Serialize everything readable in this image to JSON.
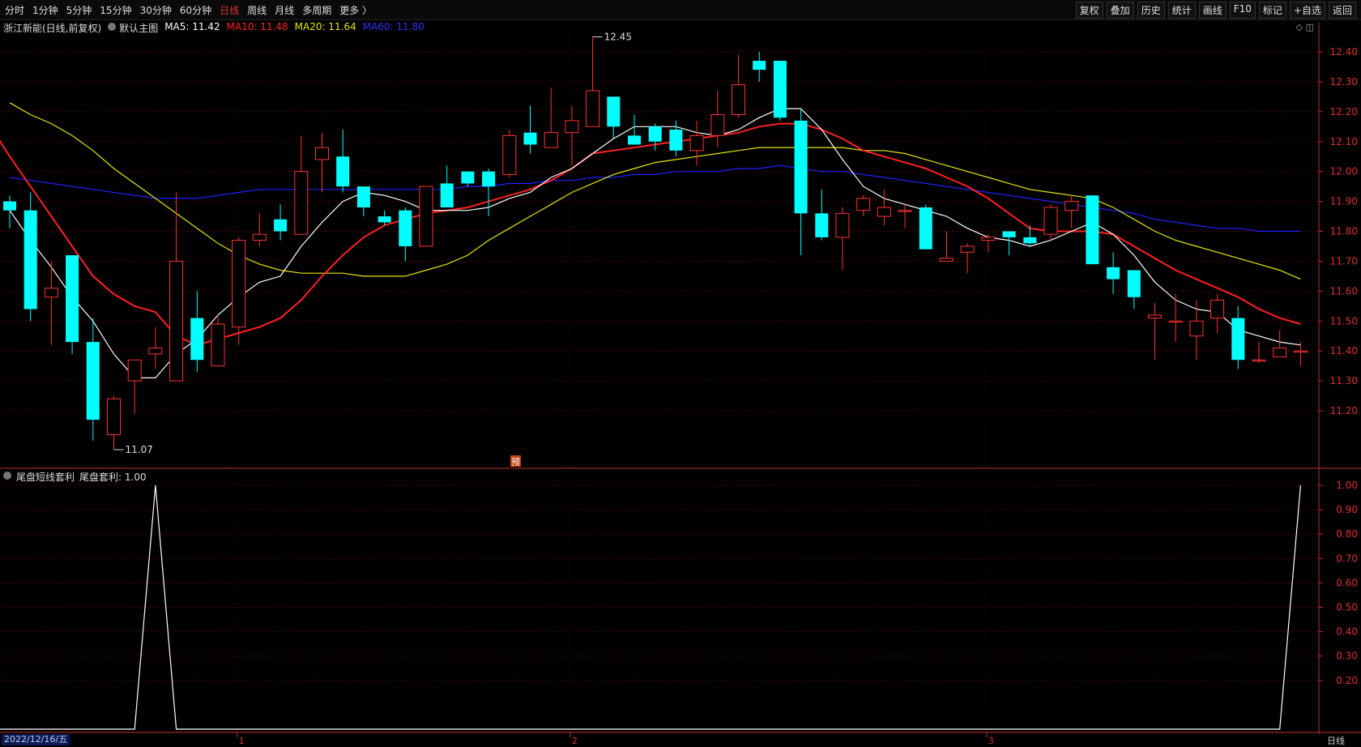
{
  "toolbar": {
    "periods": [
      "分时",
      "1分钟",
      "5分钟",
      "15分钟",
      "30分钟",
      "60分钟",
      "日线",
      "周线",
      "月线",
      "多周期",
      "更多 〉"
    ],
    "active": "日线",
    "right_buttons": [
      "复权",
      "叠加",
      "历史",
      "统计",
      "画线",
      "F10",
      "标记",
      "+自选",
      "返回"
    ]
  },
  "main_info": {
    "stock": "浙江新能(日线,前复权)",
    "template": "默认主图",
    "ma5": "MA5: 11.42",
    "ma10": "MA10: 11.48",
    "ma20": "MA20: 11.64",
    "ma60": "MA60: 11.80"
  },
  "sub_info": {
    "name": "尾盘短线套利",
    "value": "尾盘套利: 1.00"
  },
  "corner_icons": "◇ ◫",
  "pre_marker": "预",
  "bottom": {
    "date": "2022/12/16/五",
    "period": "日线"
  },
  "colors": {
    "up": "#ff3232",
    "down": "#00ffff",
    "ma5": "#ffffff",
    "ma10": "#ff2020",
    "ma20": "#e6e600",
    "ma60": "#2020ff",
    "grid": "#5a0000",
    "axis": "#c03030"
  },
  "chart_data": [
    {
      "type": "candlestick",
      "title": "浙江新能(日线,前复权)",
      "ylim": [
        11.07,
        12.45
      ],
      "yticks": [
        "12.40",
        "12.30",
        "12.20",
        "12.10",
        "12.00",
        "11.90",
        "11.80",
        "11.70",
        "11.60",
        "11.50",
        "11.40",
        "11.30",
        "11.20"
      ],
      "xticks": [
        "1",
        "2",
        "3"
      ],
      "xtick_index": [
        11,
        27,
        47
      ],
      "annotations": [
        {
          "text": "12.45",
          "index": 28,
          "value": 12.45
        },
        {
          "text": "11.07",
          "index": 5,
          "value": 11.07
        }
      ],
      "candles": [
        [
          11.9,
          11.87,
          11.92,
          11.81
        ],
        [
          11.87,
          11.54,
          11.93,
          11.5
        ],
        [
          11.58,
          11.61,
          11.7,
          11.42
        ],
        [
          11.72,
          11.43,
          11.72,
          11.39
        ],
        [
          11.43,
          11.17,
          11.51,
          11.1
        ],
        [
          11.12,
          11.24,
          11.25,
          11.07
        ],
        [
          11.3,
          11.37,
          11.37,
          11.19
        ],
        [
          11.39,
          11.41,
          11.48,
          11.34
        ],
        [
          11.3,
          11.7,
          11.93,
          11.3
        ],
        [
          11.51,
          11.37,
          11.6,
          11.33
        ],
        [
          11.35,
          11.49,
          11.52,
          11.35
        ],
        [
          11.48,
          11.77,
          11.78,
          11.42
        ],
        [
          11.77,
          11.79,
          11.86,
          11.75
        ],
        [
          11.84,
          11.8,
          11.89,
          11.77
        ],
        [
          11.79,
          12.0,
          12.12,
          11.79
        ],
        [
          12.04,
          12.08,
          12.13,
          11.93
        ],
        [
          12.05,
          11.95,
          12.14,
          11.93
        ],
        [
          11.95,
          11.88,
          11.95,
          11.85
        ],
        [
          11.85,
          11.83,
          11.87,
          11.82
        ],
        [
          11.87,
          11.75,
          11.88,
          11.7
        ],
        [
          11.75,
          11.95,
          11.95,
          11.75
        ],
        [
          11.96,
          11.88,
          12.02,
          11.88
        ],
        [
          12.0,
          11.96,
          12.0,
          11.95
        ],
        [
          12.0,
          11.95,
          12.01,
          11.85
        ],
        [
          11.99,
          12.12,
          12.14,
          11.98
        ],
        [
          12.13,
          12.09,
          12.22,
          12.06
        ],
        [
          12.08,
          12.13,
          12.28,
          12.08
        ],
        [
          12.13,
          12.17,
          12.22,
          12.02
        ],
        [
          12.15,
          12.27,
          12.45,
          12.15
        ],
        [
          12.25,
          12.15,
          12.25,
          12.11
        ],
        [
          12.12,
          12.09,
          12.19,
          12.09
        ],
        [
          12.15,
          12.1,
          12.16,
          12.07
        ],
        [
          12.14,
          12.07,
          12.17,
          12.05
        ],
        [
          12.07,
          12.12,
          12.17,
          12.02
        ],
        [
          12.12,
          12.19,
          12.27,
          12.08
        ],
        [
          12.19,
          12.29,
          12.39,
          12.18
        ],
        [
          12.37,
          12.34,
          12.4,
          12.3
        ],
        [
          12.37,
          12.18,
          12.37,
          12.17
        ],
        [
          12.17,
          11.86,
          12.21,
          11.72
        ],
        [
          11.86,
          11.78,
          11.94,
          11.77
        ],
        [
          11.78,
          11.86,
          11.88,
          11.67
        ],
        [
          11.87,
          11.91,
          11.92,
          11.85
        ],
        [
          11.85,
          11.88,
          11.94,
          11.82
        ],
        [
          11.87,
          11.87,
          11.89,
          11.81
        ],
        [
          11.88,
          11.74,
          11.89,
          11.74
        ],
        [
          11.7,
          11.71,
          11.8,
          11.7
        ],
        [
          11.73,
          11.75,
          11.76,
          11.66
        ],
        [
          11.77,
          11.78,
          11.79,
          11.73
        ],
        [
          11.8,
          11.78,
          11.8,
          11.72
        ],
        [
          11.78,
          11.76,
          11.82,
          11.75
        ],
        [
          11.79,
          11.88,
          11.89,
          11.77
        ],
        [
          11.87,
          11.9,
          11.92,
          11.81
        ],
        [
          11.92,
          11.69,
          11.92,
          11.69
        ],
        [
          11.68,
          11.64,
          11.73,
          11.59
        ],
        [
          11.67,
          11.58,
          11.67,
          11.54
        ],
        [
          11.51,
          11.52,
          11.56,
          11.37
        ],
        [
          11.5,
          11.5,
          11.59,
          11.43
        ],
        [
          11.45,
          11.5,
          11.57,
          11.37
        ],
        [
          11.51,
          11.57,
          11.59,
          11.46
        ],
        [
          11.51,
          11.37,
          11.55,
          11.34
        ],
        [
          11.37,
          11.37,
          11.43,
          11.36
        ],
        [
          11.38,
          11.41,
          11.47,
          11.38
        ],
        [
          11.4,
          11.4,
          11.43,
          11.35
        ]
      ],
      "ma5": [
        11.87,
        11.77,
        11.68,
        11.58,
        11.5,
        11.39,
        11.31,
        11.31,
        11.39,
        11.44,
        11.52,
        11.58,
        11.63,
        11.65,
        11.75,
        11.83,
        11.9,
        11.93,
        11.92,
        11.9,
        11.87,
        11.87,
        11.87,
        11.88,
        11.91,
        11.93,
        11.98,
        12.01,
        12.06,
        12.11,
        12.15,
        12.15,
        12.15,
        12.13,
        12.12,
        12.14,
        12.18,
        12.21,
        12.21,
        12.14,
        12.04,
        11.95,
        11.91,
        11.89,
        11.87,
        11.85,
        11.81,
        11.78,
        11.77,
        11.75,
        11.77,
        11.8,
        11.83,
        11.79,
        11.72,
        11.63,
        11.57,
        11.54,
        11.53,
        11.47,
        11.45,
        11.43,
        11.42
      ],
      "ma10": [
        12.16,
        12.05,
        11.95,
        11.85,
        11.75,
        11.65,
        11.59,
        11.55,
        11.53,
        11.45,
        11.42,
        11.44,
        11.46,
        11.48,
        11.51,
        11.57,
        11.65,
        11.72,
        11.78,
        11.82,
        11.84,
        11.86,
        11.87,
        11.88,
        11.9,
        11.92,
        11.94,
        11.97,
        12.01,
        12.06,
        12.07,
        12.08,
        12.09,
        12.1,
        12.11,
        12.12,
        12.13,
        12.15,
        12.16,
        12.16,
        12.14,
        12.11,
        12.07,
        12.05,
        12.03,
        12.01,
        11.98,
        11.95,
        11.91,
        11.86,
        11.81,
        11.8,
        11.8,
        11.8,
        11.79,
        11.75,
        11.71,
        11.67,
        11.64,
        11.61,
        11.58,
        11.54,
        11.51,
        11.49
      ],
      "ma20": [
        12.23,
        12.19,
        12.16,
        12.12,
        12.07,
        12.01,
        11.96,
        11.91,
        11.86,
        11.81,
        11.76,
        11.72,
        11.69,
        11.67,
        11.66,
        11.66,
        11.66,
        11.65,
        11.65,
        11.65,
        11.67,
        11.69,
        11.72,
        11.77,
        11.81,
        11.85,
        11.89,
        11.93,
        11.96,
        11.99,
        12.01,
        12.03,
        12.04,
        12.05,
        12.06,
        12.07,
        12.08,
        12.08,
        12.08,
        12.08,
        12.08,
        12.07,
        12.07,
        12.06,
        12.04,
        12.02,
        12.0,
        11.98,
        11.96,
        11.94,
        11.93,
        11.92,
        11.91,
        11.88,
        11.84,
        11.8,
        11.77,
        11.75,
        11.73,
        11.71,
        11.69,
        11.67,
        11.64
      ],
      "ma60": [
        11.98,
        11.97,
        11.96,
        11.95,
        11.94,
        11.93,
        11.92,
        11.91,
        11.91,
        11.91,
        11.92,
        11.93,
        11.94,
        11.94,
        11.94,
        11.94,
        11.94,
        11.94,
        11.94,
        11.94,
        11.94,
        11.94,
        11.95,
        11.95,
        11.96,
        11.96,
        11.97,
        11.97,
        11.98,
        11.98,
        11.99,
        11.99,
        12.0,
        12.0,
        12.0,
        12.01,
        12.01,
        12.02,
        12.01,
        12.0,
        12.0,
        11.99,
        11.98,
        11.97,
        11.96,
        11.95,
        11.94,
        11.93,
        11.92,
        11.91,
        11.9,
        11.89,
        11.88,
        11.87,
        11.86,
        11.84,
        11.83,
        11.82,
        11.81,
        11.81,
        11.8,
        11.8,
        11.8
      ]
    },
    {
      "type": "line",
      "title": "尾盘短线套利",
      "series": [
        {
          "name": "尾盘套利",
          "values": [
            0,
            0,
            0,
            0,
            0,
            0,
            0,
            1,
            0,
            0,
            0,
            0,
            0,
            0,
            0,
            0,
            0,
            0,
            0,
            0,
            0,
            0,
            0,
            0,
            0,
            0,
            0,
            0,
            0,
            0,
            0,
            0,
            0,
            0,
            0,
            0,
            0,
            0,
            0,
            0,
            0,
            0,
            0,
            0,
            0,
            0,
            0,
            0,
            0,
            0,
            0,
            0,
            0,
            0,
            0,
            0,
            0,
            0,
            0,
            0,
            0,
            0,
            1
          ]
        }
      ],
      "ylim": [
        0,
        1
      ],
      "yticks": [
        "1.00",
        "0.90",
        "0.80",
        "0.70",
        "0.60",
        "0.50",
        "0.40",
        "0.30",
        "0.20"
      ]
    }
  ]
}
